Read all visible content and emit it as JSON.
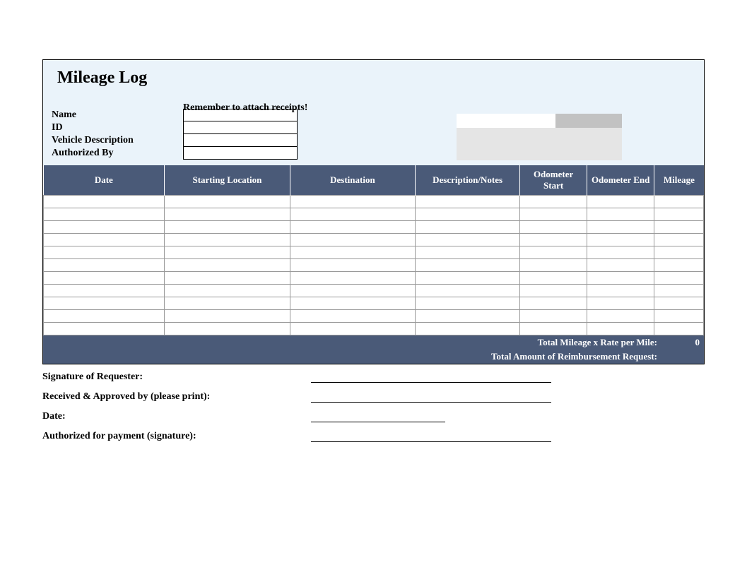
{
  "title": "Mileage Log",
  "reminder": "Remember to attach receipts!",
  "meta": {
    "name_label": "Name",
    "id_label": "ID",
    "vehicle_label": "Vehicle Description",
    "authorized_label": "Authorized By",
    "name_value": "",
    "id_value": "",
    "vehicle_value": "",
    "authorized_value": ""
  },
  "columns": {
    "date": "Date",
    "start_loc": "Starting Location",
    "destination": "Destination",
    "description": "Description/Notes",
    "odo_start": "Odometer Start",
    "odo_end": "Odometer End",
    "mileage": "Mileage"
  },
  "rows": [
    [
      "",
      "",
      "",
      "",
      "",
      "",
      ""
    ],
    [
      "",
      "",
      "",
      "",
      "",
      "",
      ""
    ],
    [
      "",
      "",
      "",
      "",
      "",
      "",
      ""
    ],
    [
      "",
      "",
      "",
      "",
      "",
      "",
      ""
    ],
    [
      "",
      "",
      "",
      "",
      "",
      "",
      ""
    ],
    [
      "",
      "",
      "",
      "",
      "",
      "",
      ""
    ],
    [
      "",
      "",
      "",
      "",
      "",
      "",
      ""
    ],
    [
      "",
      "",
      "",
      "",
      "",
      "",
      ""
    ],
    [
      "",
      "",
      "",
      "",
      "",
      "",
      ""
    ],
    [
      "",
      "",
      "",
      "",
      "",
      "",
      ""
    ],
    [
      "",
      "",
      "",
      "",
      "",
      "",
      ""
    ]
  ],
  "totals": {
    "mileage_rate_label": "Total Mileage x Rate per Mile:",
    "mileage_rate_value": "0",
    "reimbursement_label": "Total Amount of Reimbursement Request:",
    "reimbursement_value": ""
  },
  "signatures": {
    "requester": "Signature of Requester:",
    "approved": "Received & Approved by (please print):",
    "date": "Date:",
    "payment": "Authorized for payment (signature):"
  }
}
